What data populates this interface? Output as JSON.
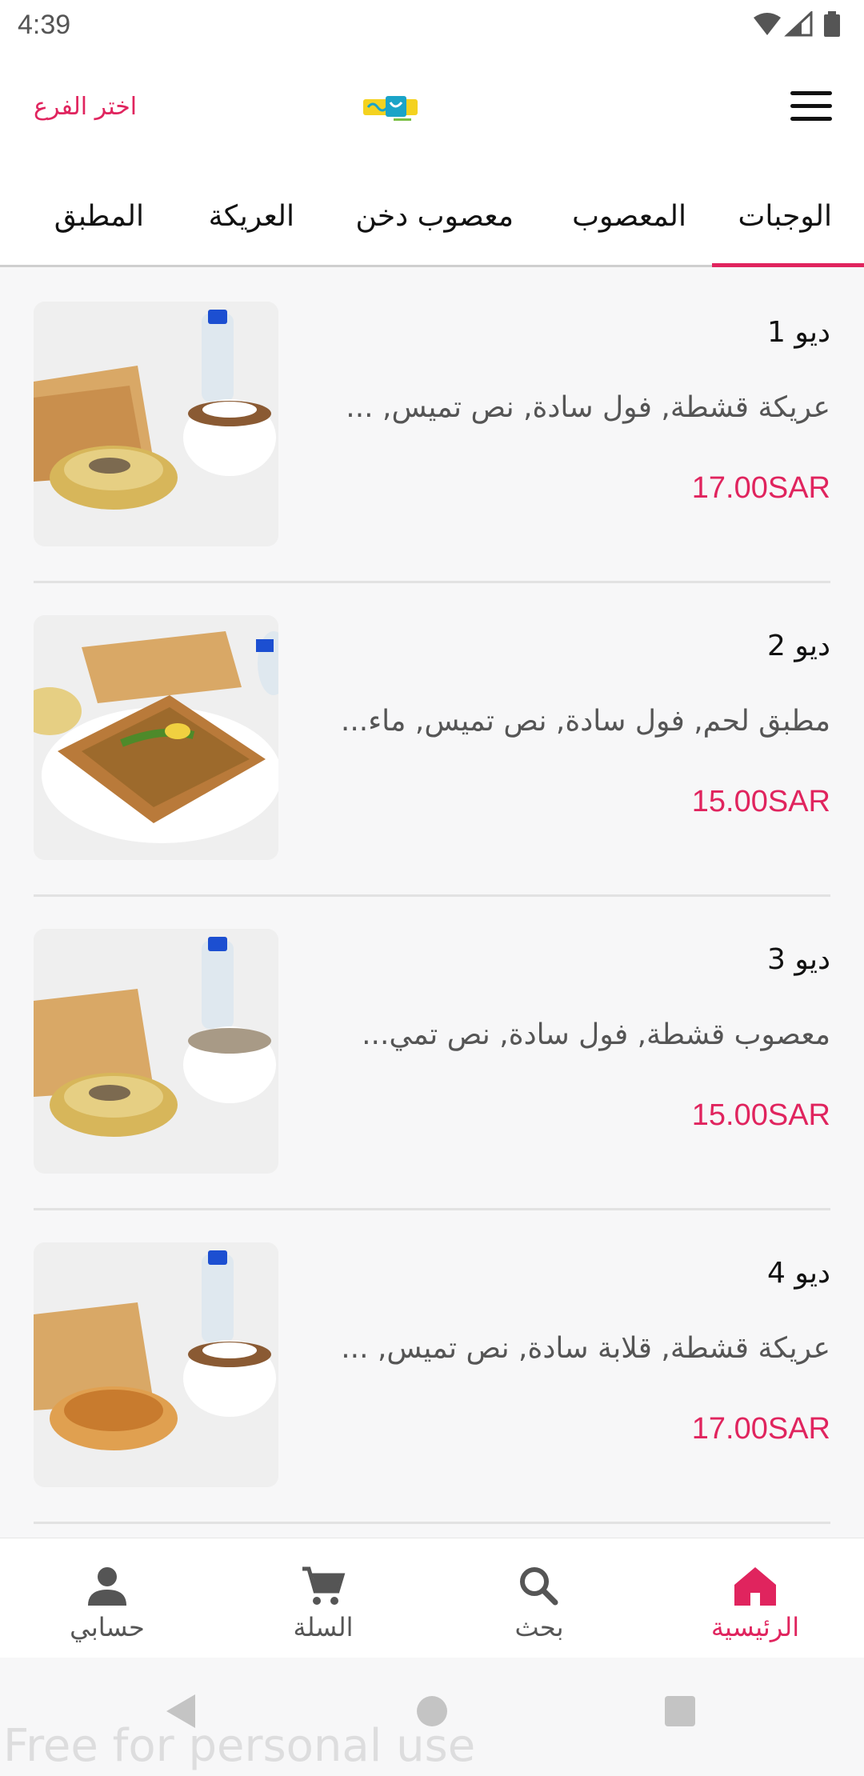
{
  "status_bar": {
    "time": "4:39"
  },
  "header": {
    "branch_link": "اختر الفرع",
    "accent_color": "#e0245e"
  },
  "tabs": [
    {
      "label": "الوجبات",
      "active": true
    },
    {
      "label": "المعصوب",
      "active": false
    },
    {
      "label": "معصوب دخن",
      "active": false
    },
    {
      "label": "العريكة",
      "active": false
    },
    {
      "label": "المطبق",
      "active": false
    }
  ],
  "items": [
    {
      "name": "ديو 1",
      "description": "عريكة قشطة, فول سادة, نص تميس, ...",
      "price": "17.00SAR"
    },
    {
      "name": "ديو 2",
      "description": "مطبق لحم, فول سادة, نص تميس, ماء...",
      "price": "15.00SAR"
    },
    {
      "name": "ديو 3",
      "description": "معصوب قشطة, فول سادة, نص تمي...",
      "price": "15.00SAR"
    },
    {
      "name": "ديو 4",
      "description": "عريكة قشطة, قلابة سادة, نص تميس, ...",
      "price": "17.00SAR"
    }
  ],
  "bottom_nav": [
    {
      "label": "الرئيسية",
      "icon": "home-icon",
      "active": true
    },
    {
      "label": "بحث",
      "icon": "search-icon",
      "active": false
    },
    {
      "label": "السلة",
      "icon": "cart-icon",
      "active": false
    },
    {
      "label": "حسابي",
      "icon": "person-icon",
      "active": false
    }
  ],
  "watermark": "Free for personal use"
}
